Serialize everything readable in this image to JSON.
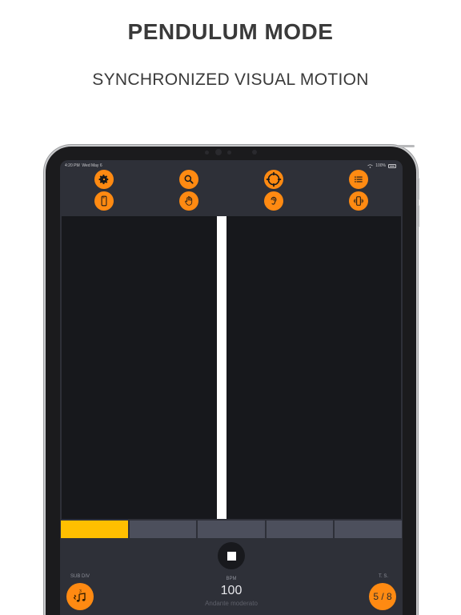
{
  "promo": {
    "title": "PENDULUM MODE",
    "subtitle": "SYNCHRONIZED VISUAL MOTION"
  },
  "status_bar": {
    "time": "4:20 PM",
    "date": "Wed May 6",
    "battery": "100%"
  },
  "toolbar": {
    "row1": [
      "gear-icon",
      "search-icon",
      "target-icon",
      "list-icon"
    ],
    "row2": [
      "phone-flash-icon",
      "hand-icon",
      "ear-icon",
      "vibrate-icon"
    ]
  },
  "beats": {
    "count": 5,
    "active_index": 0
  },
  "controls": {
    "bpm_label": "BPM",
    "bpm_value": "100",
    "tempo_name": "Andante moderato",
    "subdiv_label": "SUB DIV",
    "subdiv_value": "3",
    "ts_label": "T. S.",
    "ts_value": "5 / 8"
  },
  "colors": {
    "accent": "#ff8a12",
    "active_beat": "#ffbf00",
    "inactive_beat": "#4c4f5c",
    "screen_bg": "#2e3038",
    "pendulum_area": "#17181c",
    "pendulum_bar": "#ffffff"
  }
}
